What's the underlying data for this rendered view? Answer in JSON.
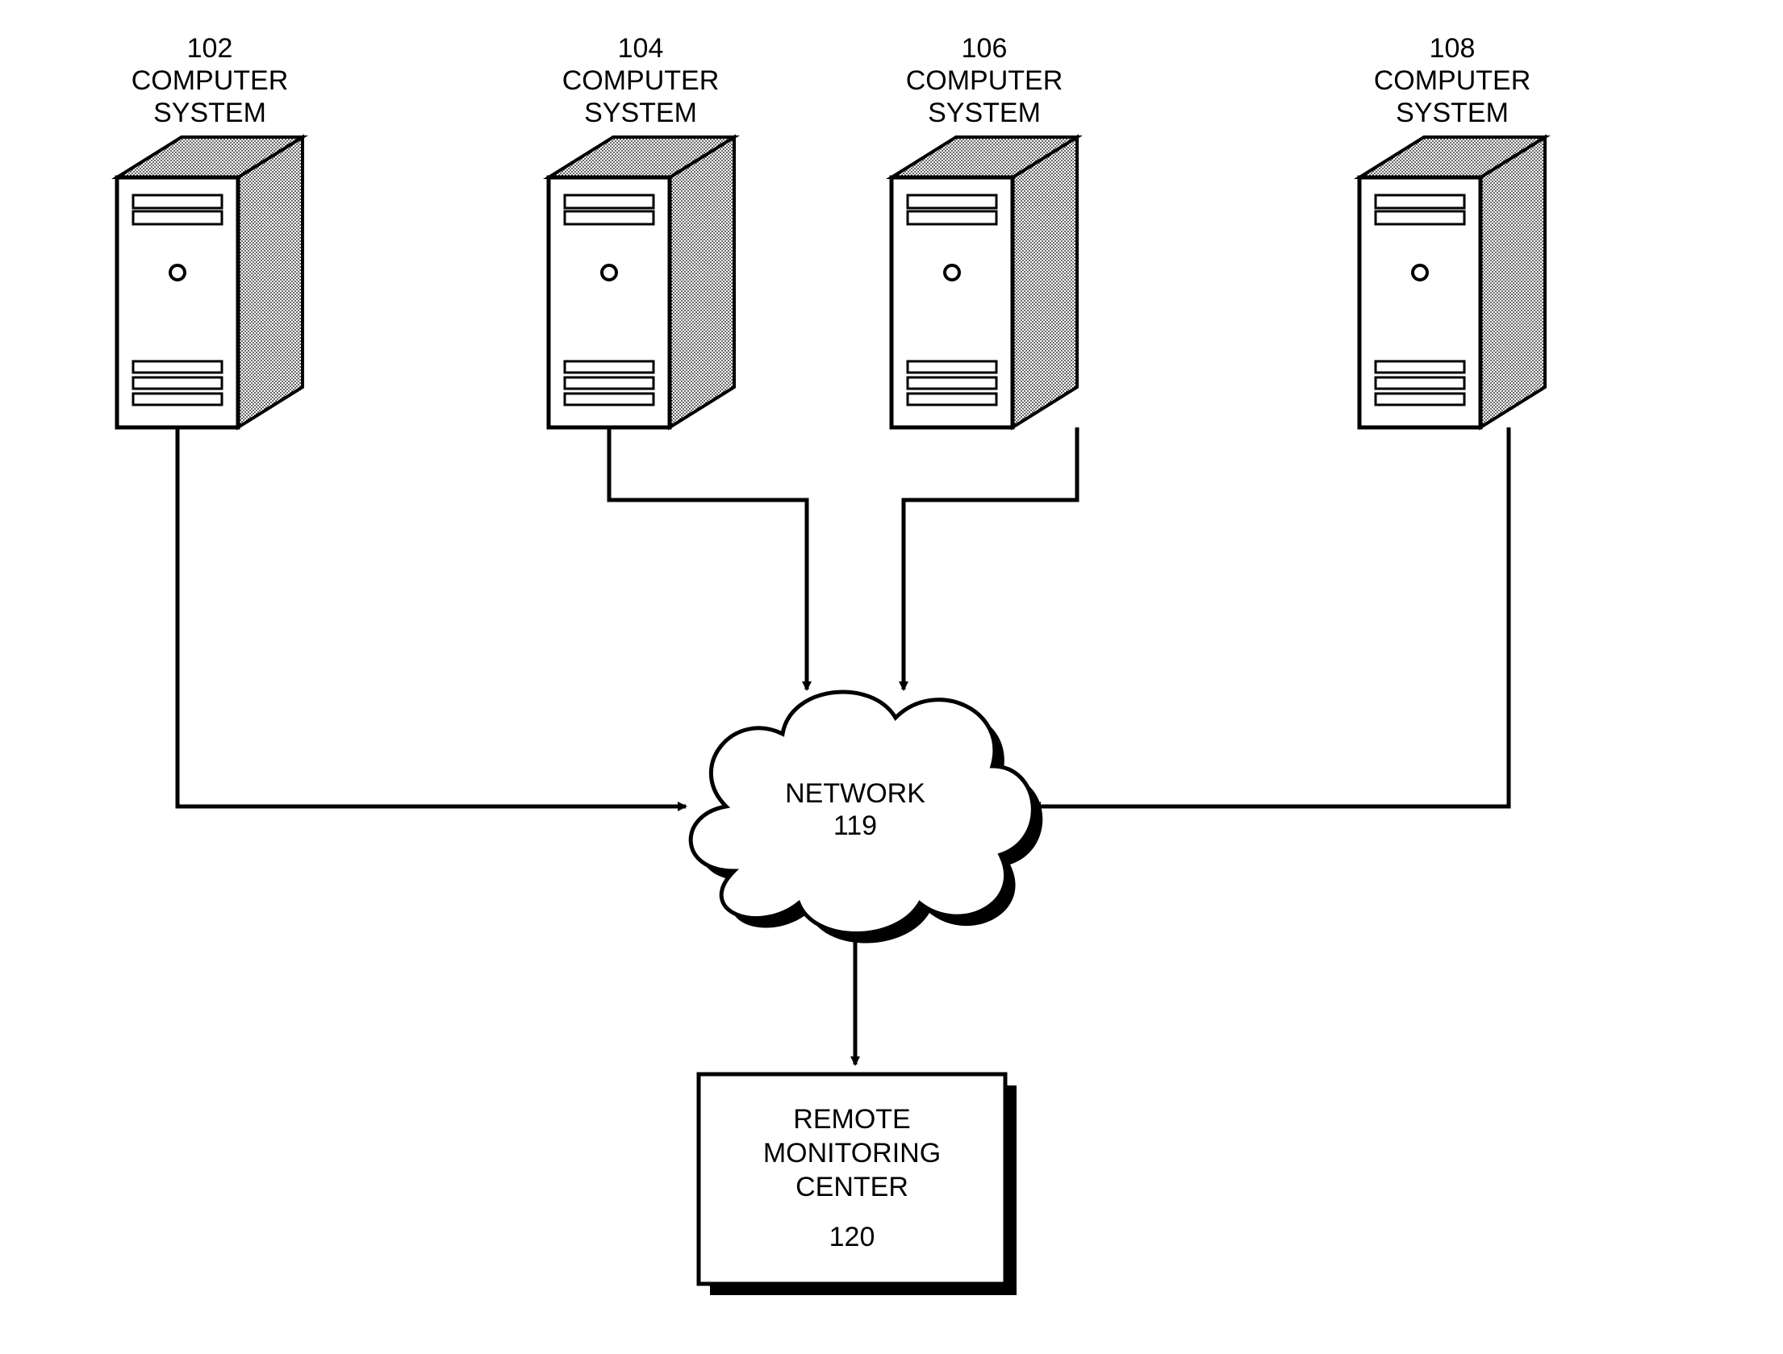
{
  "nodes": {
    "computer1": {
      "ref": "102",
      "line1": "COMPUTER",
      "line2": "SYSTEM"
    },
    "computer2": {
      "ref": "104",
      "line1": "COMPUTER",
      "line2": "SYSTEM"
    },
    "computer3": {
      "ref": "106",
      "line1": "COMPUTER",
      "line2": "SYSTEM"
    },
    "computer4": {
      "ref": "108",
      "line1": "COMPUTER",
      "line2": "SYSTEM"
    },
    "network": {
      "line1": "NETWORK",
      "line2": "119"
    },
    "remote": {
      "line1": "REMOTE",
      "line2": "MONITORING",
      "line3": "CENTER",
      "line4": "120"
    }
  }
}
